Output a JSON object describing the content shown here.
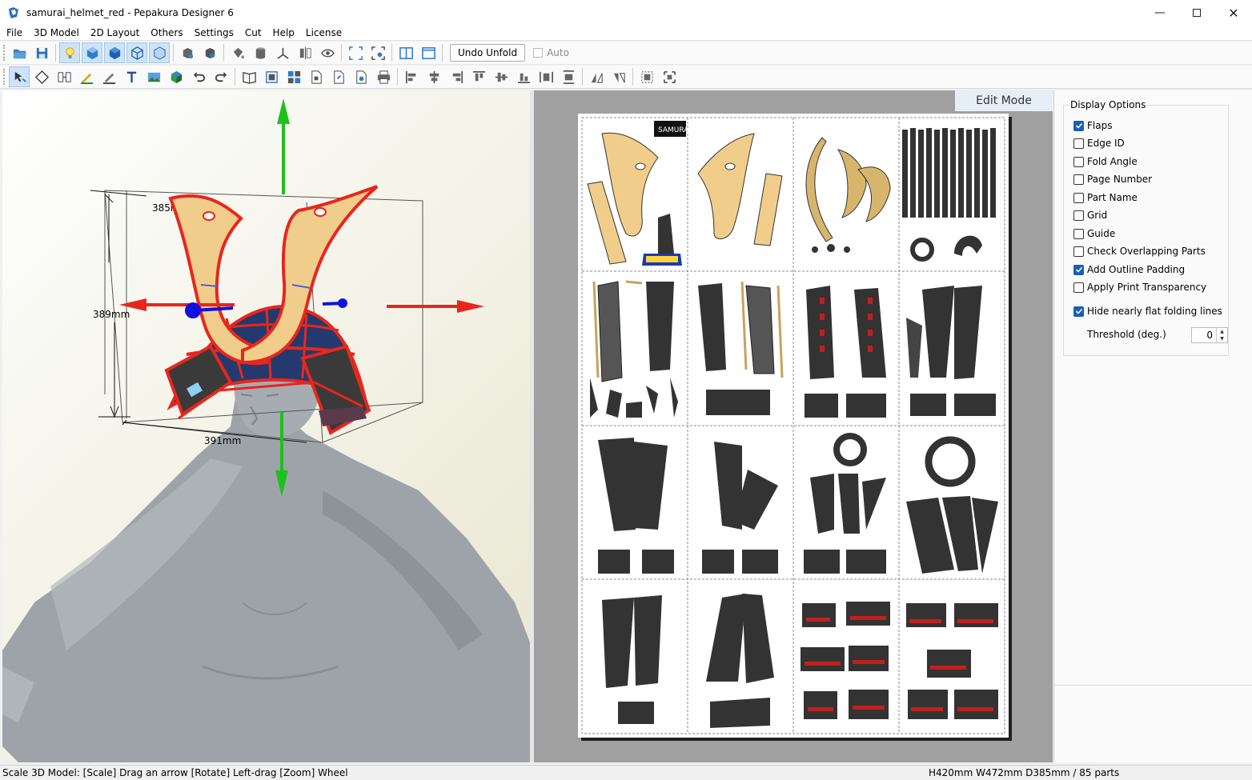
{
  "window": {
    "title": "samurai_helmet_red - Pepakura Designer 6",
    "minimize_icon": "minimize-icon",
    "maximize_icon": "maximize-icon",
    "close_icon": "close-icon"
  },
  "menu": [
    "File",
    "3D Model",
    "2D Layout",
    "Others",
    "Settings",
    "Cut",
    "Help",
    "License"
  ],
  "toolbar": {
    "undo_unfold": "Undo Unfold",
    "auto_label": "Auto",
    "auto_checked": false
  },
  "view3d": {
    "dim_width": "385mm",
    "dim_height": "389mm",
    "dim_depth": "391mm"
  },
  "view2d": {
    "mode_label": "Edit Mode",
    "logo_text": "SAMURAI",
    "columns": 4,
    "rows": 4
  },
  "display_options": {
    "title": "Display Options",
    "items": [
      {
        "label": "Flaps",
        "checked": true
      },
      {
        "label": "Edge ID",
        "checked": false
      },
      {
        "label": "Fold Angle",
        "checked": false
      },
      {
        "label": "Page Number",
        "checked": false
      },
      {
        "label": "Part Name",
        "checked": false
      },
      {
        "label": "Grid",
        "checked": false
      },
      {
        "label": "Guide",
        "checked": false
      },
      {
        "label": "Check Overlapping Parts",
        "checked": false
      },
      {
        "label": "Add Outline Padding",
        "checked": true
      },
      {
        "label": "Apply Print Transparency",
        "checked": false
      },
      {
        "label": "Hide nearly flat folding lines",
        "checked": true
      }
    ],
    "threshold_label": "Threshold (deg.)",
    "threshold_value": "0"
  },
  "status": {
    "left": "Scale 3D Model: [Scale] Drag an arrow  [Rotate] Left-drag  [Zoom] Wheel",
    "right": "H420mm W472mm D385mm / 85 parts"
  },
  "colors": {
    "accent": "#1a5fb4",
    "helmet_red": "#e8261d",
    "horn_tan": "#f1cd8c",
    "part_dark": "#2e2e2e",
    "arrow_green": "#1ec01e",
    "arrow_blue": "#1010e0"
  }
}
